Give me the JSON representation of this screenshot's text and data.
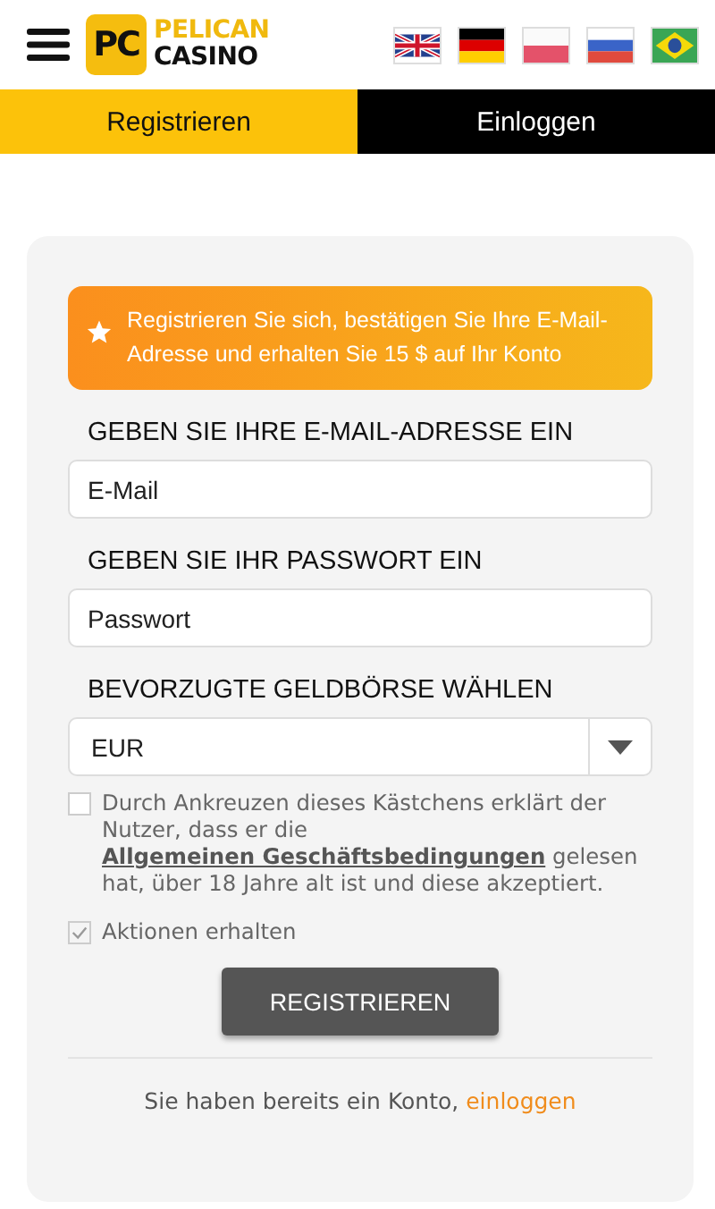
{
  "header": {
    "logo_mark": "PC",
    "logo_top": "PELICAN",
    "logo_bottom": "CASINO"
  },
  "tabs": [
    {
      "label": "Registrieren",
      "selected": true
    },
    {
      "label": "Einloggen",
      "selected": false
    }
  ],
  "banner": "Registrieren Sie sich, bestätigen Sie Ihre E-Mail-Adresse und erhalten Sie 15 $ auf Ihr Konto",
  "fields": [
    {
      "label": "GEBEN SIE IHRE E-MAIL-ADRESSE EIN",
      "kind": "input",
      "placeholder": "E-Mail"
    },
    {
      "label": "GEBEN SIE IHR PASSWORT EIN",
      "kind": "input",
      "placeholder": "Passwort"
    },
    {
      "label": "BEVORZUGTE GELDBÖRSE WÄHLEN",
      "kind": "select",
      "value": "EUR"
    }
  ],
  "terms": {
    "checked": false,
    "before": "Durch Ankreuzen dieses Kästchens erklärt der Nutzer, dass er die",
    "link": "Allgemeinen Geschäftsbedingungen",
    "after": "gelesen hat, über 18 Jahre alt ist und diese akzeptiert."
  },
  "promo": {
    "checked": true,
    "label": "Aktionen erhalten"
  },
  "submit": "REGISTRIEREN",
  "footer": {
    "text": "Sie haben bereits ein Konto,",
    "link": "einloggen"
  }
}
